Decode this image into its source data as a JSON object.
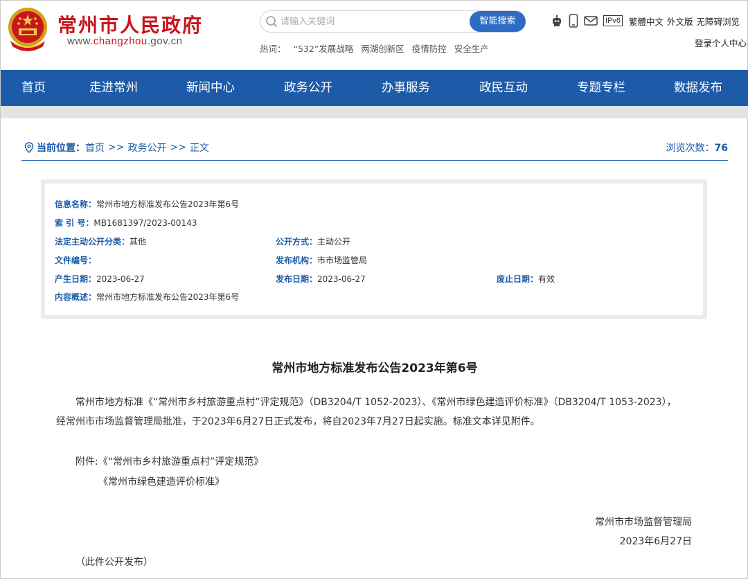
{
  "header": {
    "site_name": "常州市人民政府",
    "site_url_prefix": "www.",
    "site_url_highlight": "changzhou",
    "site_url_suffix": ".gov.cn",
    "search_placeholder": "请输入关键词",
    "search_button": "智能搜索",
    "hot_label": "热词：",
    "hot_words": [
      "“532”发展战略",
      "两湖创新区",
      "疫情防控",
      "安全生产"
    ],
    "ipv6_label": "IPv6",
    "top_links": [
      "繁體中文",
      "外文版",
      "无障碍浏览"
    ],
    "login": "登录个人中心",
    "colors": {
      "brand_red": "#c8161d",
      "nav_blue": "#1d5ba9",
      "search_blue": "#2d6bc5"
    }
  },
  "nav": {
    "items": [
      "首页",
      "走进常州",
      "新闻中心",
      "政务公开",
      "办事服务",
      "政民互动",
      "专题专栏",
      "数据发布"
    ]
  },
  "breadcrumb": {
    "label": "当前位置：",
    "crumbs": [
      "首页",
      "政务公开",
      "正文"
    ],
    "separator": ">>",
    "views_label": "浏览次数：",
    "views_count": "76"
  },
  "info": {
    "name_k": "信息名称：",
    "name_v": "常州市地方标准发布公告2023年第6号",
    "index_k": "索 引 号：",
    "index_v": "MB1681397/2023-00143",
    "category_k": "法定主动公开分类：",
    "category_v": "其他",
    "method_k": "公开方式：",
    "method_v": "主动公开",
    "docno_k": "文件编号：",
    "docno_v": "",
    "org_k": "发布机构：",
    "org_v": "市市场监管局",
    "created_k": "产生日期：",
    "created_v": "2023-06-27",
    "published_k": "发布日期：",
    "published_v": "2023-06-27",
    "expire_k": "废止日期：",
    "expire_v": "有效",
    "summary_k": "内容概述：",
    "summary_v": "常州市地方标准发布公告2023年第6号"
  },
  "article": {
    "title": "常州市地方标准发布公告2023年第6号",
    "paragraph": "常州市地方标准《“常州市乡村旅游重点村”评定规范》（DB3204/T 1052-2023）、《常州市绿色建造评价标准》（DB3204/T 1053-2023），经常州市市场监督管理局批准，于2023年6月27日正式发布，将自2023年7月27日起实施。标准文本详见附件。",
    "attachment_1": "附件:《“常州市乡村旅游重点村”评定规范》",
    "attachment_2": "《常州市绿色建造评价标准》",
    "sign_org": "常州市市场监督管理局",
    "sign_date": "2023年6月27日",
    "footnote": "（此件公开发布）"
  }
}
